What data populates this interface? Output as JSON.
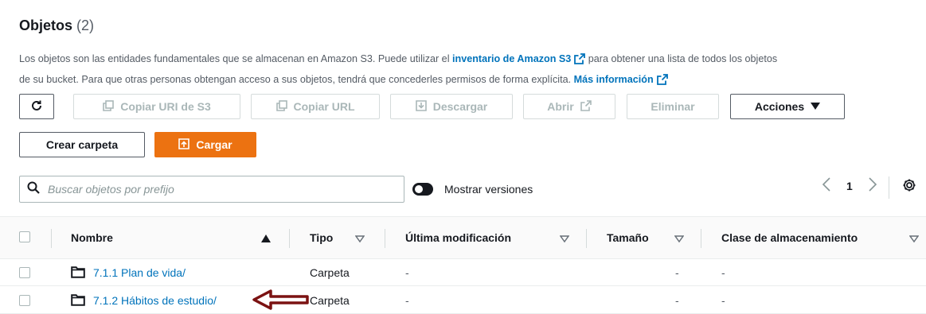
{
  "header": {
    "title": "Objetos",
    "count": "(2)"
  },
  "description": {
    "part1": "Los objetos son las entidades fundamentales que se almacenan en Amazon S3. Puede utilizar el ",
    "link1": "inventario de Amazon S3",
    "part2": " para obtener una lista de todos los objetos",
    "part3": "de su bucket. Para que otras personas obtengan acceso a sus objetos, tendrá que concederles permisos de forma explícita. ",
    "link2": "Más información"
  },
  "toolbar": {
    "refresh_icon": "refresh-icon",
    "copy_uri": "Copiar URI de S3",
    "copy_url": "Copiar URL",
    "download": "Descargar",
    "open": "Abrir",
    "delete": "Eliminar",
    "actions": "Acciones",
    "create_folder": "Crear carpeta",
    "upload": "Cargar",
    "upload_color": "#ec7211"
  },
  "search": {
    "placeholder": "Buscar objetos por prefijo"
  },
  "versions_toggle": {
    "label": "Mostrar versiones"
  },
  "pagination": {
    "page": "1"
  },
  "table": {
    "columns": {
      "name": "Nombre",
      "type": "Tipo",
      "modified": "Última modificación",
      "size": "Tamaño",
      "storage_class": "Clase de almacenamiento"
    },
    "rows": [
      {
        "name": "7.1.1 Plan de vida/",
        "type": "Carpeta",
        "modified": "-",
        "size": "-",
        "storage_class": "-"
      },
      {
        "name": "7.1.2 Hábitos de estudio/",
        "type": "Carpeta",
        "modified": "-",
        "size": "-",
        "storage_class": "-"
      }
    ]
  },
  "annotation": {
    "arrow_color": "#7b1212"
  },
  "colors": {
    "link": "#0073bb",
    "text": "#16191f",
    "muted": "#545b64"
  }
}
